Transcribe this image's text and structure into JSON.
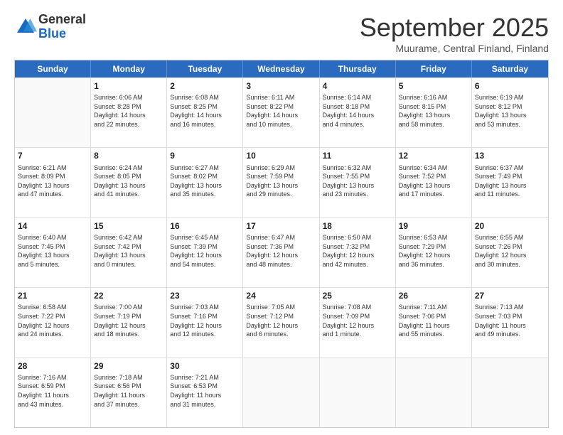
{
  "logo": {
    "general": "General",
    "blue": "Blue"
  },
  "header": {
    "month": "September 2025",
    "location": "Muurame, Central Finland, Finland"
  },
  "days": [
    "Sunday",
    "Monday",
    "Tuesday",
    "Wednesday",
    "Thursday",
    "Friday",
    "Saturday"
  ],
  "weeks": [
    [
      {
        "day": "",
        "info": ""
      },
      {
        "day": "1",
        "info": "Sunrise: 6:06 AM\nSunset: 8:28 PM\nDaylight: 14 hours\nand 22 minutes."
      },
      {
        "day": "2",
        "info": "Sunrise: 6:08 AM\nSunset: 8:25 PM\nDaylight: 14 hours\nand 16 minutes."
      },
      {
        "day": "3",
        "info": "Sunrise: 6:11 AM\nSunset: 8:22 PM\nDaylight: 14 hours\nand 10 minutes."
      },
      {
        "day": "4",
        "info": "Sunrise: 6:14 AM\nSunset: 8:18 PM\nDaylight: 14 hours\nand 4 minutes."
      },
      {
        "day": "5",
        "info": "Sunrise: 6:16 AM\nSunset: 8:15 PM\nDaylight: 13 hours\nand 58 minutes."
      },
      {
        "day": "6",
        "info": "Sunrise: 6:19 AM\nSunset: 8:12 PM\nDaylight: 13 hours\nand 53 minutes."
      }
    ],
    [
      {
        "day": "7",
        "info": "Sunrise: 6:21 AM\nSunset: 8:09 PM\nDaylight: 13 hours\nand 47 minutes."
      },
      {
        "day": "8",
        "info": "Sunrise: 6:24 AM\nSunset: 8:05 PM\nDaylight: 13 hours\nand 41 minutes."
      },
      {
        "day": "9",
        "info": "Sunrise: 6:27 AM\nSunset: 8:02 PM\nDaylight: 13 hours\nand 35 minutes."
      },
      {
        "day": "10",
        "info": "Sunrise: 6:29 AM\nSunset: 7:59 PM\nDaylight: 13 hours\nand 29 minutes."
      },
      {
        "day": "11",
        "info": "Sunrise: 6:32 AM\nSunset: 7:55 PM\nDaylight: 13 hours\nand 23 minutes."
      },
      {
        "day": "12",
        "info": "Sunrise: 6:34 AM\nSunset: 7:52 PM\nDaylight: 13 hours\nand 17 minutes."
      },
      {
        "day": "13",
        "info": "Sunrise: 6:37 AM\nSunset: 7:49 PM\nDaylight: 13 hours\nand 11 minutes."
      }
    ],
    [
      {
        "day": "14",
        "info": "Sunrise: 6:40 AM\nSunset: 7:45 PM\nDaylight: 13 hours\nand 5 minutes."
      },
      {
        "day": "15",
        "info": "Sunrise: 6:42 AM\nSunset: 7:42 PM\nDaylight: 13 hours\nand 0 minutes."
      },
      {
        "day": "16",
        "info": "Sunrise: 6:45 AM\nSunset: 7:39 PM\nDaylight: 12 hours\nand 54 minutes."
      },
      {
        "day": "17",
        "info": "Sunrise: 6:47 AM\nSunset: 7:36 PM\nDaylight: 12 hours\nand 48 minutes."
      },
      {
        "day": "18",
        "info": "Sunrise: 6:50 AM\nSunset: 7:32 PM\nDaylight: 12 hours\nand 42 minutes."
      },
      {
        "day": "19",
        "info": "Sunrise: 6:53 AM\nSunset: 7:29 PM\nDaylight: 12 hours\nand 36 minutes."
      },
      {
        "day": "20",
        "info": "Sunrise: 6:55 AM\nSunset: 7:26 PM\nDaylight: 12 hours\nand 30 minutes."
      }
    ],
    [
      {
        "day": "21",
        "info": "Sunrise: 6:58 AM\nSunset: 7:22 PM\nDaylight: 12 hours\nand 24 minutes."
      },
      {
        "day": "22",
        "info": "Sunrise: 7:00 AM\nSunset: 7:19 PM\nDaylight: 12 hours\nand 18 minutes."
      },
      {
        "day": "23",
        "info": "Sunrise: 7:03 AM\nSunset: 7:16 PM\nDaylight: 12 hours\nand 12 minutes."
      },
      {
        "day": "24",
        "info": "Sunrise: 7:05 AM\nSunset: 7:12 PM\nDaylight: 12 hours\nand 6 minutes."
      },
      {
        "day": "25",
        "info": "Sunrise: 7:08 AM\nSunset: 7:09 PM\nDaylight: 12 hours\nand 1 minute."
      },
      {
        "day": "26",
        "info": "Sunrise: 7:11 AM\nSunset: 7:06 PM\nDaylight: 11 hours\nand 55 minutes."
      },
      {
        "day": "27",
        "info": "Sunrise: 7:13 AM\nSunset: 7:03 PM\nDaylight: 11 hours\nand 49 minutes."
      }
    ],
    [
      {
        "day": "28",
        "info": "Sunrise: 7:16 AM\nSunset: 6:59 PM\nDaylight: 11 hours\nand 43 minutes."
      },
      {
        "day": "29",
        "info": "Sunrise: 7:18 AM\nSunset: 6:56 PM\nDaylight: 11 hours\nand 37 minutes."
      },
      {
        "day": "30",
        "info": "Sunrise: 7:21 AM\nSunset: 6:53 PM\nDaylight: 11 hours\nand 31 minutes."
      },
      {
        "day": "",
        "info": ""
      },
      {
        "day": "",
        "info": ""
      },
      {
        "day": "",
        "info": ""
      },
      {
        "day": "",
        "info": ""
      }
    ]
  ]
}
